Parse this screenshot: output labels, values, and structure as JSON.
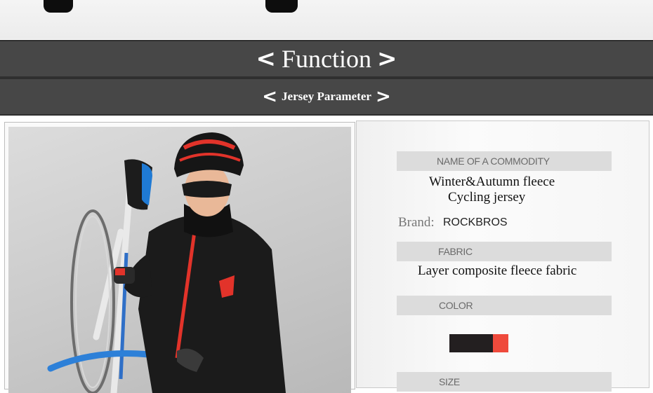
{
  "banners": {
    "function_title": "Function",
    "parameter_title": "Jersey Parameter",
    "left_chevron": "<",
    "right_chevron": ">"
  },
  "specs": {
    "commodity_label": "NAME OF A COMMODITY",
    "commodity_line1": "Winter&Autumn fleece",
    "commodity_line2": "Cycling jersey",
    "brand_label": "Brand:",
    "brand_value": "ROCKBROS",
    "fabric_label": "FABRIC",
    "fabric_value": "Layer composite fleece fabric",
    "color_label": "COLOR",
    "size_label": "SIZE"
  },
  "colors": {
    "banner_bg": "#474747",
    "swatch_black": "#231f20",
    "swatch_red": "#ef4a3c",
    "label_bar": "#dcdcdc"
  },
  "icons": [
    "cyclist-photo"
  ]
}
